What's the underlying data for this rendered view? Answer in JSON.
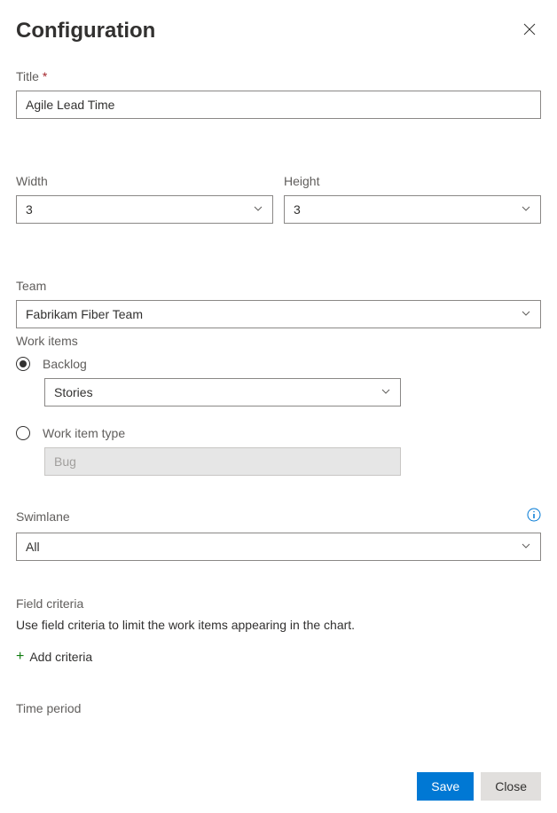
{
  "header": {
    "title": "Configuration"
  },
  "fields": {
    "title": {
      "label": "Title",
      "value": "Agile Lead Time"
    },
    "width": {
      "label": "Width",
      "value": "3"
    },
    "height": {
      "label": "Height",
      "value": "3"
    },
    "team": {
      "label": "Team",
      "value": "Fabrikam Fiber Team"
    },
    "workItems": {
      "label": "Work items",
      "backlog": {
        "label": "Backlog",
        "value": "Stories"
      },
      "workItemType": {
        "label": "Work item type",
        "value": "Bug"
      }
    },
    "swimlane": {
      "label": "Swimlane",
      "value": "All"
    },
    "fieldCriteria": {
      "label": "Field criteria",
      "description": "Use field criteria to limit the work items appearing in the chart.",
      "addLabel": "Add criteria"
    },
    "timePeriod": {
      "label": "Time period"
    }
  },
  "footer": {
    "save": "Save",
    "close": "Close"
  }
}
